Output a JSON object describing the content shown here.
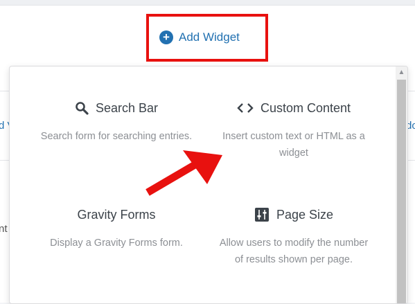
{
  "add_widget": {
    "label": "Add Widget",
    "icon": "plus-circle-icon"
  },
  "edge": {
    "left_top": "d V",
    "left_bottom": "nt",
    "right_top": "do"
  },
  "widgets": [
    {
      "title": "Search Bar",
      "icon": "search-icon",
      "description": "Search form for searching entries."
    },
    {
      "title": "Custom Content",
      "icon": "code-icon",
      "description": "Insert custom text or HTML as a widget"
    },
    {
      "title": "Gravity Forms",
      "icon": "",
      "description": "Display a Gravity Forms form."
    },
    {
      "title": "Page Size",
      "icon": "page-size-icon",
      "description": "Allow users to modify the number of results shown per page."
    }
  ],
  "colors": {
    "accent": "#2271b1",
    "highlight": "#e8110f",
    "muted_text": "#8c8f94",
    "title_text": "#3c434a"
  }
}
